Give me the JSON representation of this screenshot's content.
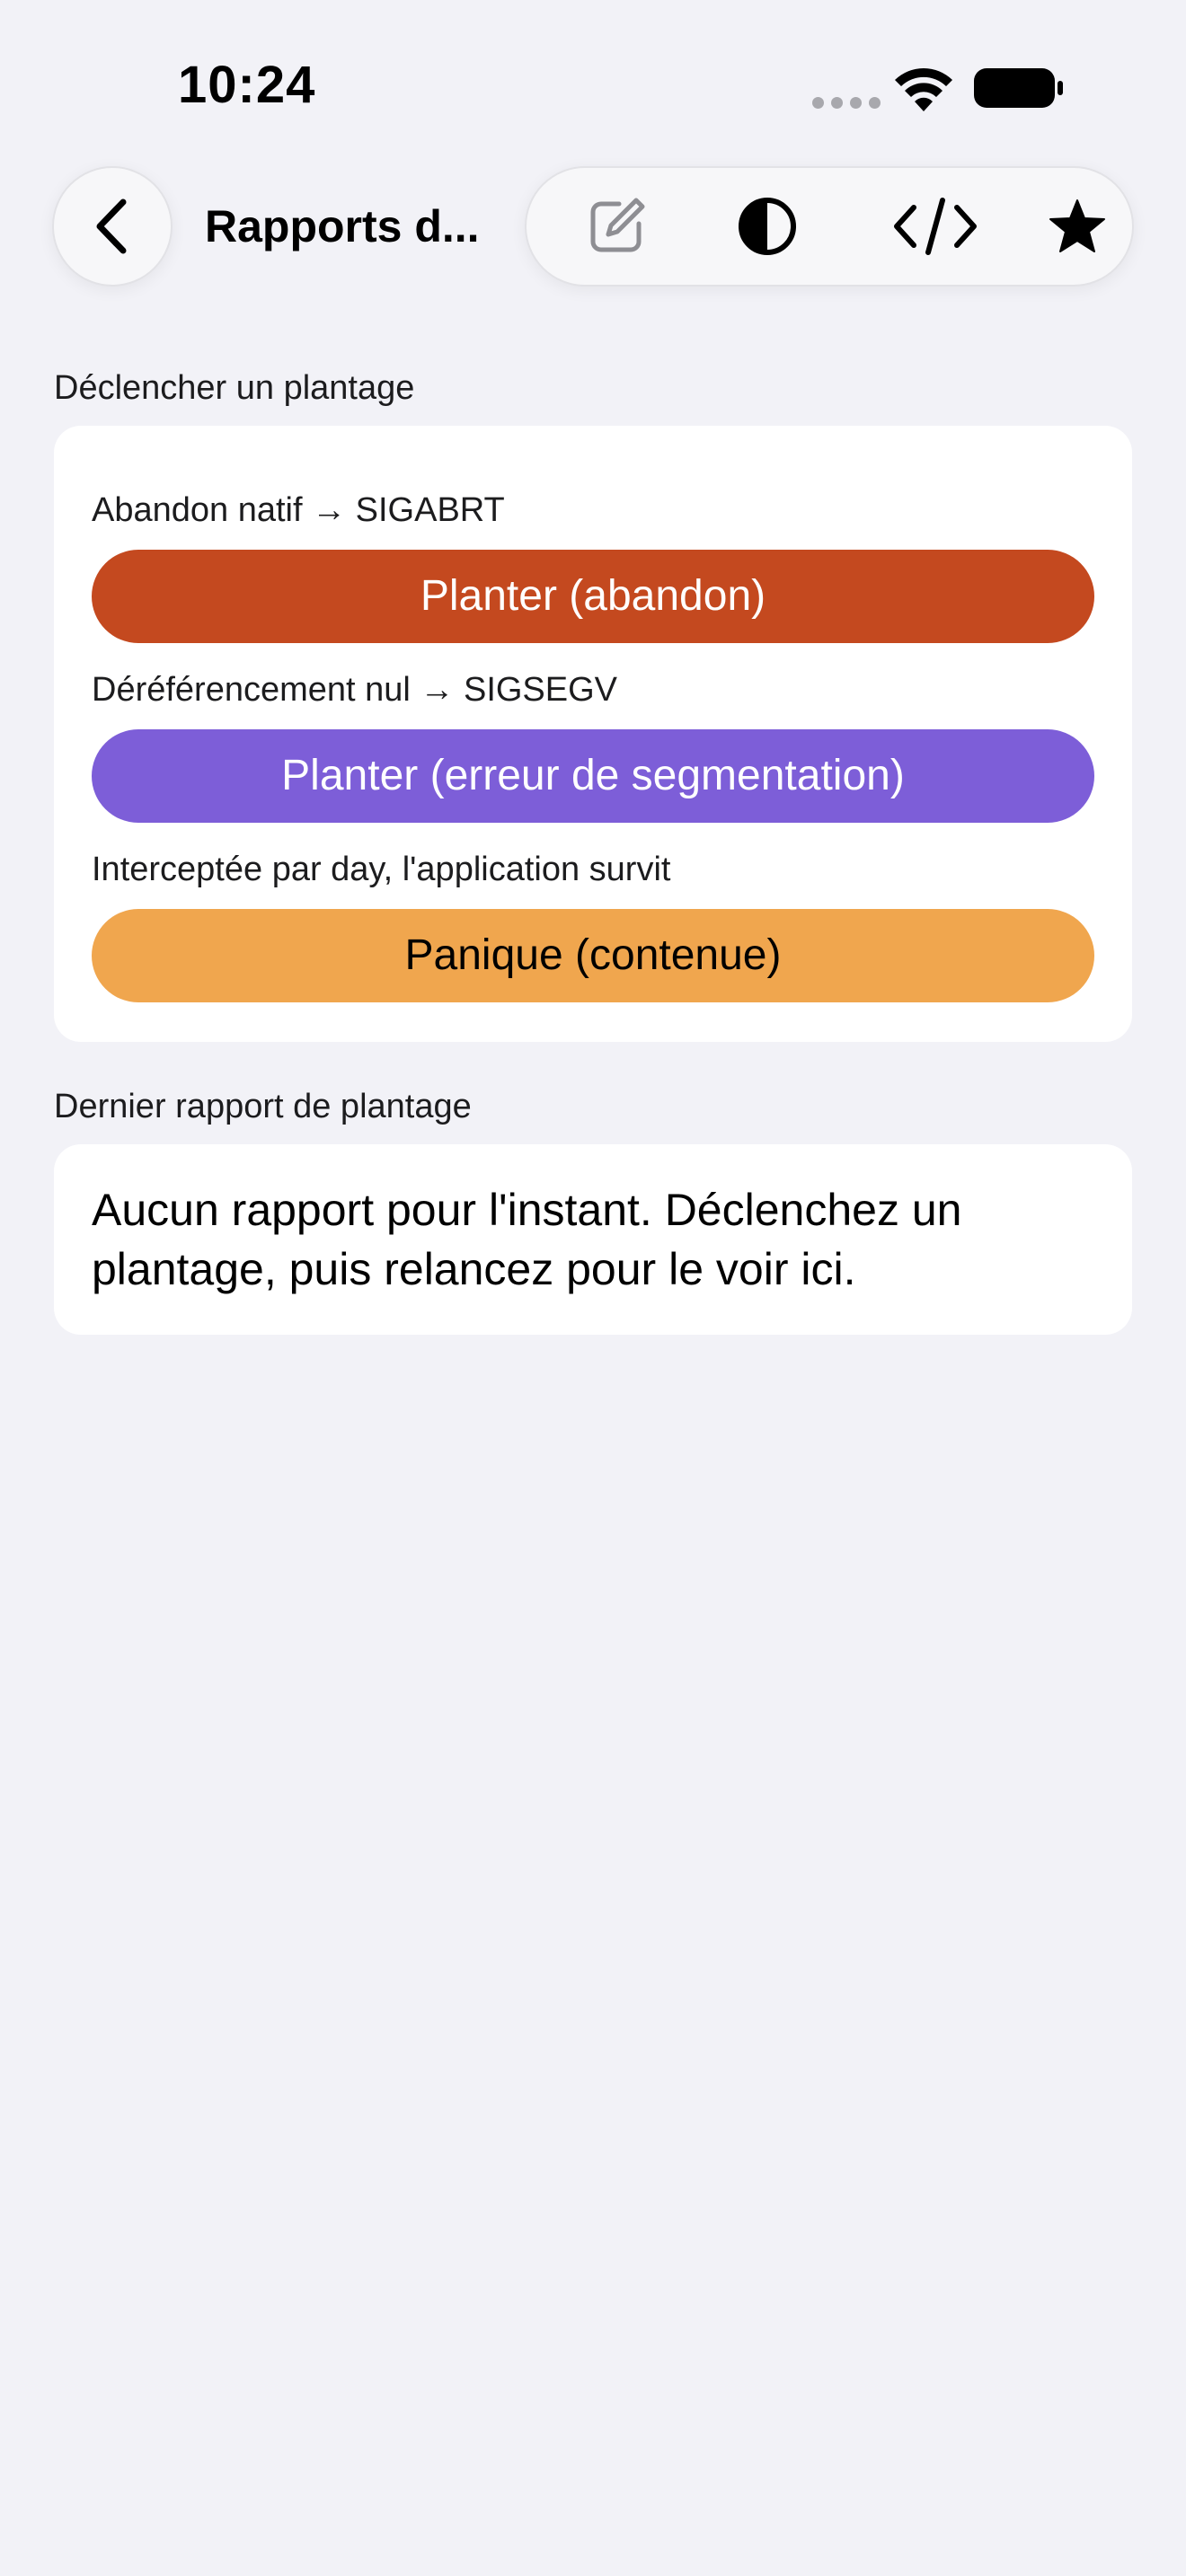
{
  "status_bar": {
    "time": "10:24"
  },
  "nav": {
    "title": "Rapports d...",
    "back_icon": "chevron-left-icon",
    "toolbar_icons": [
      "compose-icon",
      "contrast-icon",
      "code-icon",
      "star-icon"
    ]
  },
  "sections": {
    "trigger": {
      "header": "Déclencher un plantage",
      "items": [
        {
          "caption": "Abandon natif → SIGABRT",
          "button": "Planter (abandon)",
          "color": "#c4491f"
        },
        {
          "caption": "Déréférencement nul → SIGSEGV",
          "button": "Planter (erreur de segmentation)",
          "color": "#7d5ed8"
        },
        {
          "caption": "Interceptée par day, l'application survit",
          "button": "Panique (contenue)",
          "color": "#f0a64e"
        }
      ]
    },
    "last_report": {
      "header": "Dernier rapport de plantage",
      "empty_text": "Aucun rapport pour l'instant. Déclenchez un plantage, puis relancez pour le voir ici."
    }
  }
}
